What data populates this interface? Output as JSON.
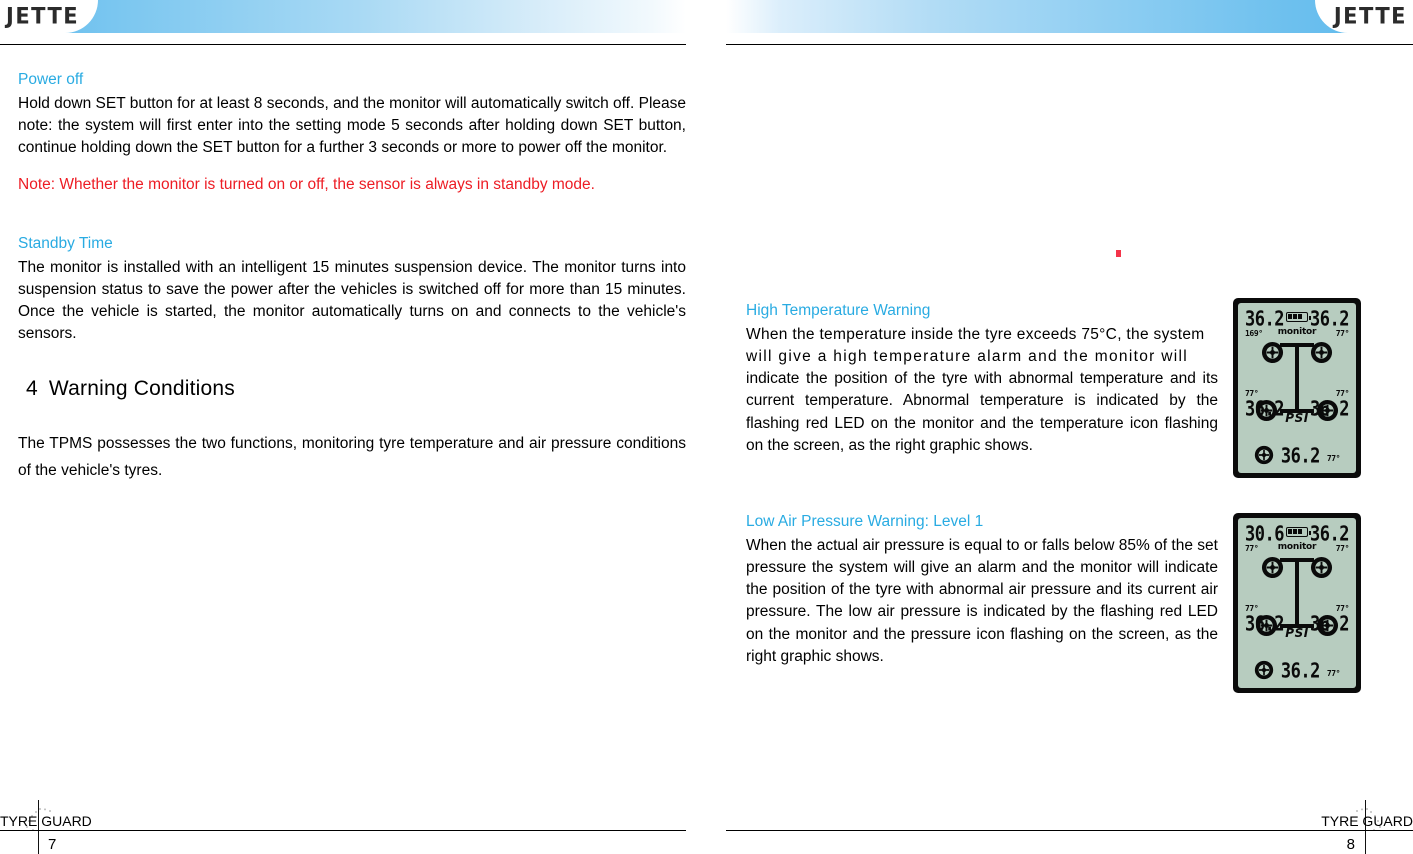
{
  "brand": {
    "logo": "JETTE",
    "footer_label": "TYRE GUARD"
  },
  "left_page": {
    "page_number": "7",
    "power_off": {
      "heading": "Power off",
      "body": "Hold down SET button for at least 8 seconds, and the monitor will automatically switch off. Please note: the system will first enter into the setting mode 5 seconds after holding down SET button, continue holding down the SET button for a further 3 seconds or more to power off the monitor."
    },
    "note": "Note: Whether the monitor is turned on or off, the sensor is always in standby mode.",
    "standby_time": {
      "heading": "Standby Time",
      "body": "The monitor is installed with an intelligent 15 minutes suspension device. The monitor turns into suspension status to save the power after the vehicles is switched off for more than 15 minutes. Once the vehicle is started, the monitor automatically turns on and connects to the vehicle's sensors."
    },
    "warning_conditions": {
      "number": "4",
      "heading": "Warning Conditions",
      "body": "The TPMS possesses the two functions, monitoring tyre temperature and air pressure conditions of the vehicle's tyres."
    }
  },
  "right_page": {
    "page_number": "8",
    "high_temperature": {
      "heading": "High Temperature Warning",
      "line1": "When the temperature inside the tyre exceeds 75°C, the system",
      "line2": "will give a high temperature alarm and the monitor will",
      "line3": "indicate the position of the tyre with abnormal temperature and its current temperature. Abnormal temperature is indicated by the flashing red LED on the monitor and the temperature icon flashing on the screen, as the right graphic shows."
    },
    "low_air_pressure": {
      "heading": "Low Air Pressure Warning: Level 1",
      "body": "When the actual air pressure is equal to or falls below 85% of the set pressure the system will give an alarm and the monitor will indicate the position of the tyre with abnormal air pressure and its current air pressure. The low air pressure is indicated by the flashing red LED on the monitor and the pressure icon flashing on the screen, as the right graphic shows."
    },
    "lcd_high_temp": {
      "monitor_label": "monitor",
      "unit": "PSI",
      "front_left_pressure": "36.2",
      "front_left_temp": "169°",
      "front_right_pressure": "36.2",
      "front_right_temp": "77°",
      "rear_left_pressure": "36.2",
      "rear_left_temp": "77°",
      "rear_right_pressure": "36.2",
      "rear_right_temp": "77°",
      "spare_pressure": "36.2",
      "spare_temp": "77°"
    },
    "lcd_low_pressure": {
      "monitor_label": "monitor",
      "unit": "PSI",
      "front_left_pressure": "30.6",
      "front_left_temp": "77°",
      "front_right_pressure": "36.2",
      "front_right_temp": "77°",
      "rear_left_pressure": "36.2",
      "rear_left_temp": "77°",
      "rear_right_pressure": "36.2",
      "rear_right_temp": "77°",
      "spare_pressure": "36.2",
      "spare_temp": "77°"
    }
  },
  "colors": {
    "heading_blue": "#29abe2",
    "note_red": "#ed1c24",
    "header_blue": "#62bced",
    "lcd_screen": "#b7ccbf"
  }
}
